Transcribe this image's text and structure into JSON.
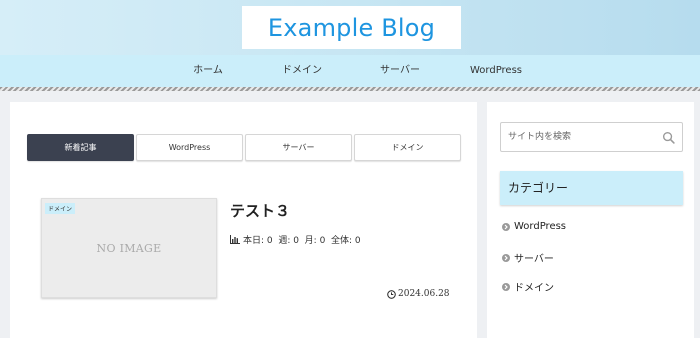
{
  "header": {
    "site_title": "Example Blog"
  },
  "nav": {
    "items": [
      "ホーム",
      "ドメイン",
      "サーバー",
      "WordPress"
    ]
  },
  "tabs": [
    {
      "label": "新着記事",
      "active": true
    },
    {
      "label": "WordPress",
      "active": false
    },
    {
      "label": "サーバー",
      "active": false
    },
    {
      "label": "ドメイン",
      "active": false
    }
  ],
  "post": {
    "category_badge": "ドメイン",
    "thumbnail_text": "NO IMAGE",
    "title": "テスト３",
    "stats": "本日: 0  週: 0  月: 0  全体: 0",
    "date": "2024.06.28"
  },
  "sidebar": {
    "search_placeholder": "サイト内を検索",
    "category_heading": "カテゴリー",
    "categories": [
      "WordPress",
      "サーバー",
      "ドメイン"
    ]
  },
  "colors": {
    "brand": "#1e95e0",
    "nav_bg": "#cbeefa",
    "active_tab": "#3b4150"
  },
  "icons": {
    "search": "search-icon",
    "stats": "bar-chart-icon",
    "date": "clock-icon",
    "category_bullet": "chevron-circle-icon"
  }
}
